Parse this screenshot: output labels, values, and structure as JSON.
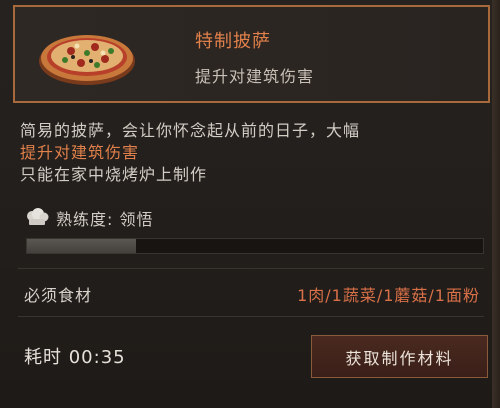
{
  "item": {
    "title": "特制披萨",
    "effect": "提升对建筑伤害",
    "icon": "pizza-icon"
  },
  "description": {
    "line1": "简易的披萨，会让你怀念起从前的日子，大幅",
    "line2": "提升对建筑伤害",
    "line3": "只能在家中烧烤炉上制作"
  },
  "proficiency": {
    "label": "熟练度: 领悟",
    "icon": "chef-hat-icon",
    "progress": 0.24
  },
  "ingredients": {
    "label": "必须食材",
    "value": "1肉/1蔬菜/1蘑菇/1面粉"
  },
  "craft": {
    "time_label": "耗时 00:35",
    "button_label": "获取制作材料"
  },
  "colors": {
    "accent": "#e0804a",
    "border": "#a86a3a",
    "panel": "#262220"
  }
}
